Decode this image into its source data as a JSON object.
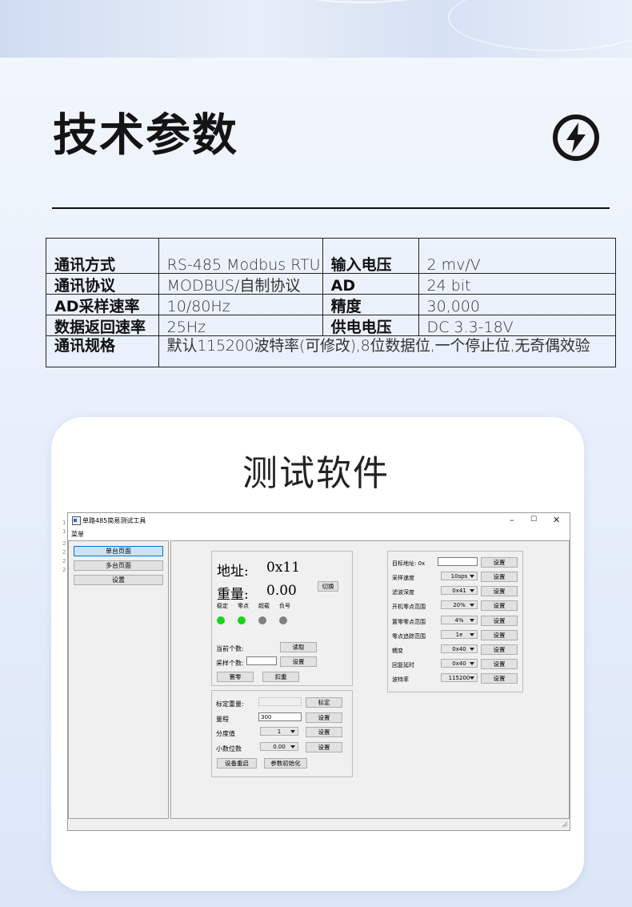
{
  "header": {
    "title": "技术参数",
    "icon": "lightning-bolt-icon"
  },
  "spec_table": [
    {
      "k1": "通讯方式",
      "v1": "RS-485 Modbus RTU",
      "k2": "输入电压",
      "v2": "2 mv/V"
    },
    {
      "k1": "通讯协议",
      "v1": "MODBUS/自制协议",
      "k2": "AD",
      "v2": "24 bit"
    },
    {
      "k1": "AD采样速率",
      "v1": "10/80Hz",
      "k2": "精度",
      "v2": "30,000"
    },
    {
      "k1": "数据返回速率",
      "v1": "25Hz",
      "k2": "供电电压",
      "v2": "DC 3.3-18V"
    },
    {
      "k1": "通讯规格",
      "v1": "默认115200波特率(可修改),8位数据位,一个停止位,无奇偶效验"
    }
  ],
  "card": {
    "title": "测试软件"
  },
  "app": {
    "window_title": "单路485简易测试工具",
    "menu": "菜单",
    "left_numbers": [
      "1",
      "1",
      "2",
      "2",
      "2",
      "2"
    ],
    "nav": [
      {
        "label": "单台页面",
        "selected": true
      },
      {
        "label": "多台页面",
        "selected": false
      },
      {
        "label": "设置",
        "selected": false
      }
    ],
    "device": {
      "address_label": "地址:",
      "address_value": "0x11",
      "weight_label": "重量:",
      "weight_value": "0.00",
      "switch_button": "切换",
      "indicators": [
        {
          "label": "稳定",
          "color": "#19d219"
        },
        {
          "label": "零点",
          "color": "#19d219"
        },
        {
          "label": "超载",
          "color": "#808080"
        },
        {
          "label": "负号",
          "color": "#808080"
        }
      ],
      "current_count_label": "当前个数:",
      "read_button": "读取",
      "sample_count_label": "采样个数:",
      "sample_count_value": "",
      "set_button": "设置",
      "zero_button": "置零",
      "tare_button": "扣重"
    },
    "calibration": {
      "cal_weight_label": "标定重量:",
      "cal_weight_value": "",
      "cal_button": "标定",
      "range_label": "量程",
      "range_value": "300",
      "division_label": "分度值",
      "division_value": "1",
      "decimals_label": "小数位数",
      "decimals_value": "0.00",
      "set_label": "设置",
      "restart_button": "设备重启",
      "init_button": "参数初始化"
    },
    "settings": {
      "target_addr_label": "目标地址: 0x",
      "target_addr_value": "",
      "set_label": "设置",
      "rows": [
        {
          "label": "采样速度",
          "value": "10sps"
        },
        {
          "label": "滤波深度",
          "value": "0x41"
        },
        {
          "label": "开机零点范围",
          "value": "20%"
        },
        {
          "label": "置零零点范围",
          "value": "4%"
        },
        {
          "label": "零点追踪范围",
          "value": "1e"
        },
        {
          "label": "蠕变",
          "value": "0x40"
        },
        {
          "label": "回复延时",
          "value": "0x40"
        },
        {
          "label": "波特率",
          "value": "115200"
        }
      ]
    },
    "window_controls": {
      "minimize": "–",
      "maximize": "☐",
      "close": "✕"
    }
  }
}
